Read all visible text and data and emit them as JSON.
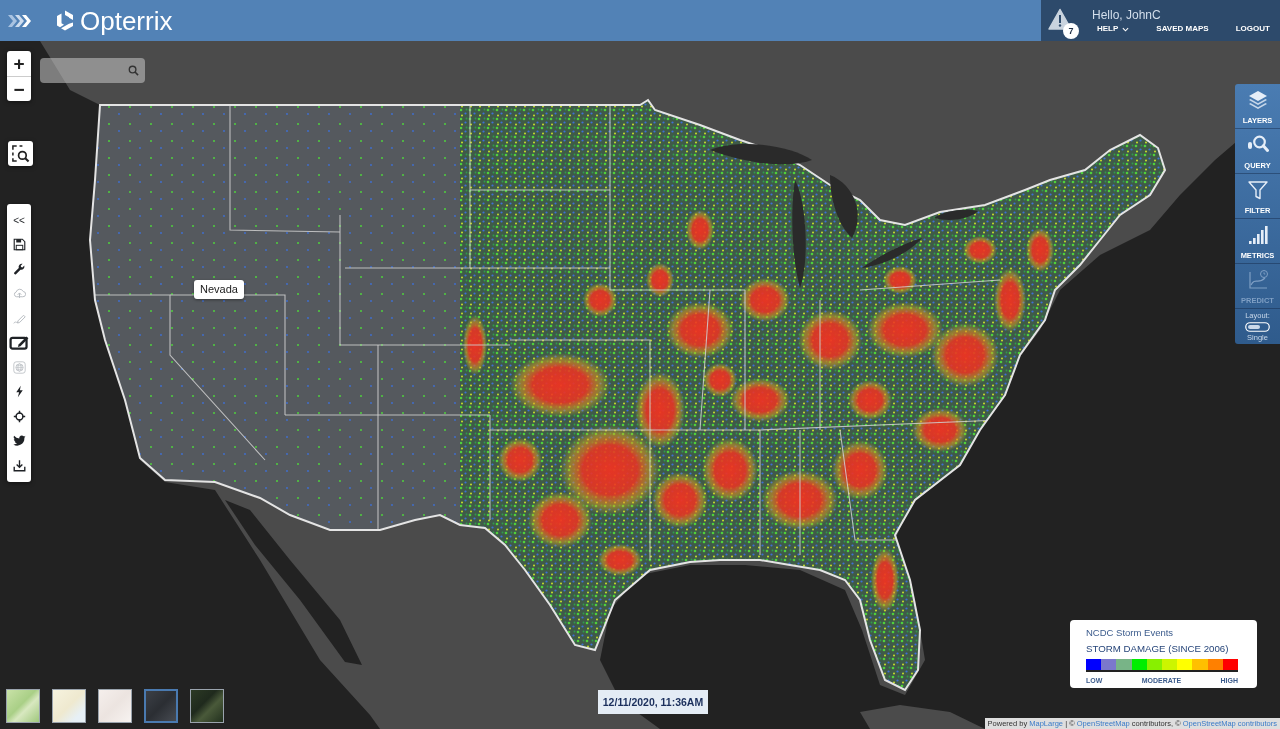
{
  "header": {
    "brand": "Opterrix",
    "alert_count": "7",
    "greeting": "Hello, JohnC",
    "menu": [
      {
        "label": "HELP",
        "kind": "dropdown"
      },
      {
        "label": "SAVED MAPS",
        "kind": "link"
      },
      {
        "label": "LOGOUT",
        "kind": "link"
      }
    ]
  },
  "zoom": {
    "zoom_in": "+",
    "zoom_out": "−"
  },
  "tools": [
    {
      "kind": "collapse",
      "label": "<<",
      "disabled": false
    },
    {
      "kind": "save",
      "disabled": false
    },
    {
      "kind": "tools",
      "disabled": false
    },
    {
      "kind": "upload",
      "disabled": true
    },
    {
      "kind": "draw",
      "disabled": true
    },
    {
      "kind": "edit",
      "disabled": false
    },
    {
      "kind": "web",
      "disabled": true
    },
    {
      "kind": "quick",
      "disabled": false
    },
    {
      "kind": "locate",
      "disabled": false
    },
    {
      "kind": "tweet",
      "disabled": false
    },
    {
      "kind": "download",
      "disabled": false
    }
  ],
  "map": {
    "tooltip": "Nevada"
  },
  "side_panel": {
    "items": [
      {
        "label": "LAYERS",
        "kind": "layers",
        "disabled": false
      },
      {
        "label": "QUERY",
        "kind": "query",
        "disabled": false
      },
      {
        "label": "FILTER",
        "kind": "filter",
        "disabled": false
      },
      {
        "label": "METRICS",
        "kind": "metrics",
        "disabled": false
      },
      {
        "label": "PREDICT",
        "kind": "predict",
        "disabled": true
      }
    ],
    "layout": {
      "label": "Layout:",
      "value": "Single"
    }
  },
  "legend": {
    "source": "NCDC Storm Events",
    "title": "STORM DAMAGE (SINCE 2006)",
    "swatches": [
      {
        "color": "#0000ff"
      },
      {
        "color": "#7b78cc"
      },
      {
        "color": "#78b487"
      },
      {
        "color": "#00ee00"
      },
      {
        "color": "#88f000"
      },
      {
        "color": "#ccf500"
      },
      {
        "color": "#ffff00"
      },
      {
        "color": "#ffc000"
      },
      {
        "color": "#ff8000"
      },
      {
        "color": "#ff0000"
      }
    ],
    "labels": [
      "LOW",
      "MODERATE",
      "HIGH"
    ]
  },
  "basemaps": [
    {
      "kind": "terrain",
      "selected": false
    },
    {
      "kind": "streets",
      "selected": false
    },
    {
      "kind": "light",
      "selected": false
    },
    {
      "kind": "dark",
      "selected": true
    },
    {
      "kind": "satellite",
      "selected": false
    }
  ],
  "timestamp": "12/11/2020, 11:36AM",
  "attribution": [
    {
      "kind": "text",
      "text": "Powered by "
    },
    {
      "kind": "link",
      "text": "MapLarge"
    },
    {
      "kind": "text",
      "text": " | © "
    },
    {
      "kind": "link",
      "text": "OpenStreetMap"
    },
    {
      "kind": "text",
      "text": " contributors, © "
    },
    {
      "kind": "link",
      "text": "OpenStreetMap contributors"
    }
  ]
}
